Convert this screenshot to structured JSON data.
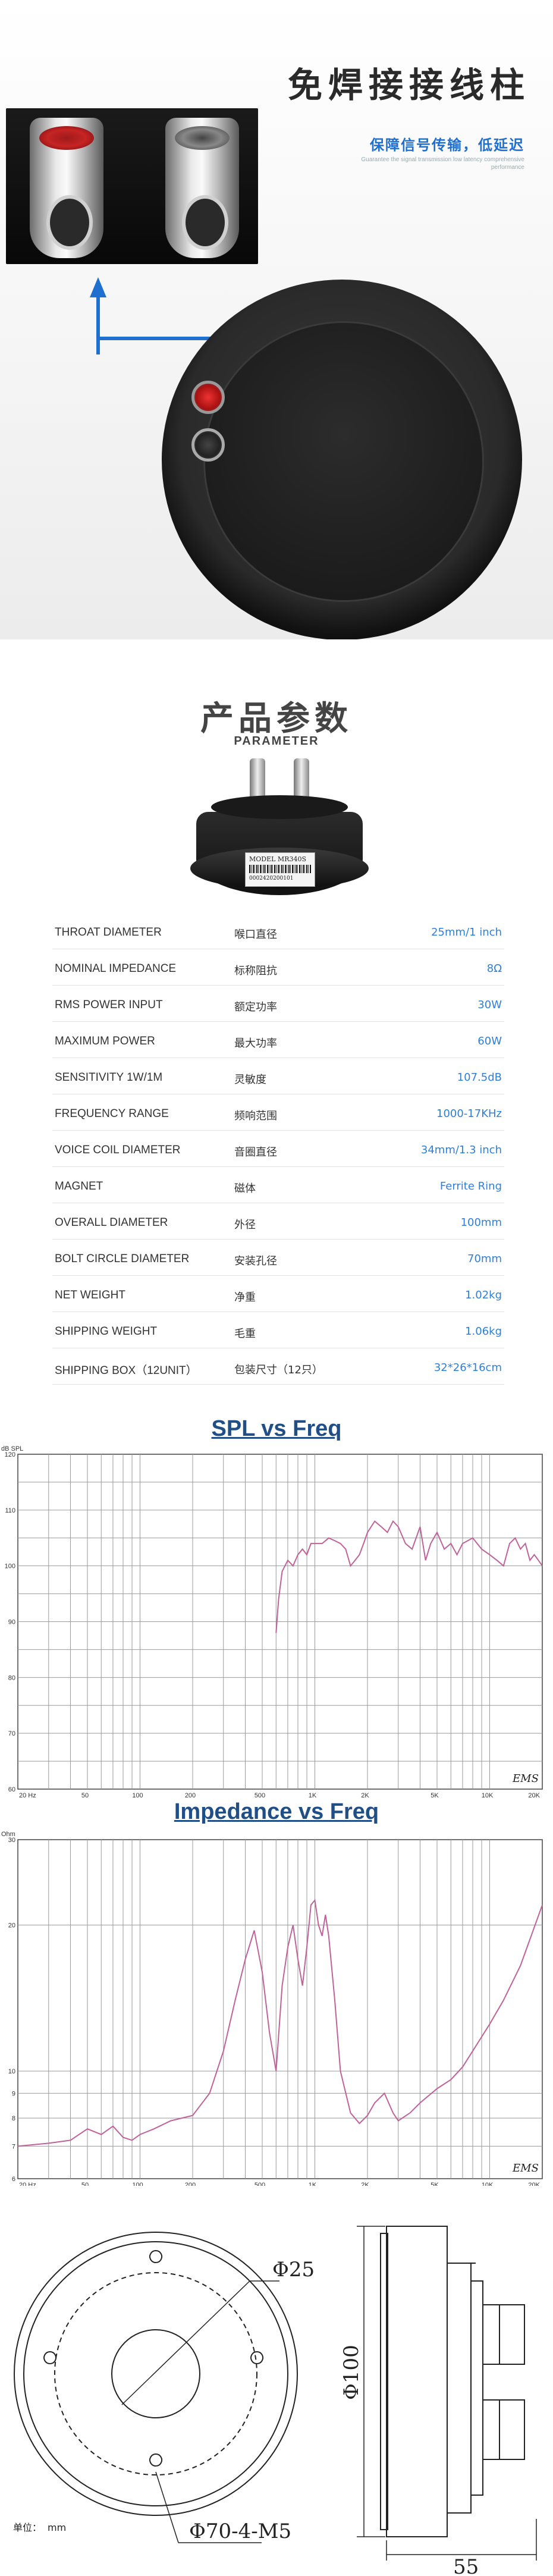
{
  "terminal": {
    "title": "免焊接接线柱",
    "subtitle": "保障信号传输，低延迟",
    "small_text": "Guarantee the signal transmission low latency comprehensive performance"
  },
  "parameters": {
    "title": "产品参数",
    "subtitle": "PARAMETER",
    "product_label": {
      "model": "MODEL MR340S",
      "serial": "0002420200101"
    },
    "rows": [
      {
        "en": "THROAT DIAMETER",
        "cn": "喉口直径",
        "value": "25mm/1 inch"
      },
      {
        "en": "NOMINAL IMPEDANCE",
        "cn": "标称阻抗",
        "value": "8Ω"
      },
      {
        "en": "RMS POWER INPUT",
        "cn": "额定功率",
        "value": "30W"
      },
      {
        "en": "MAXIMUM POWER",
        "cn": "最大功率",
        "value": "60W"
      },
      {
        "en": "SENSITIVITY 1W/1M",
        "cn": "灵敏度",
        "value": "107.5dB"
      },
      {
        "en": "FREQUENCY RANGE",
        "cn": "频响范围",
        "value": "1000-17KHz"
      },
      {
        "en": "VOICE COIL DIAMETER",
        "cn": "音圈直径",
        "value": "34mm/1.3 inch"
      },
      {
        "en": "MAGNET",
        "cn": "磁体",
        "value": "Ferrite Ring"
      },
      {
        "en": "OVERALL DIAMETER",
        "cn": "外径",
        "value": "100mm"
      },
      {
        "en": "BOLT CIRCLE DIAMETER",
        "cn": "安装孔径",
        "value": "70mm"
      },
      {
        "en": "NET WEIGHT",
        "cn": "净重",
        "value": "1.02kg"
      },
      {
        "en": "SHIPPING WEIGHT",
        "cn": "毛重",
        "value": "1.06kg"
      },
      {
        "en": "SHIPPING BOX（12UNIT）",
        "cn": "包装尺寸（12只）",
        "value": "32*26*16cm"
      }
    ]
  },
  "chart_data": [
    {
      "type": "line",
      "title": "SPL vs Freq",
      "ylabel": "dB SPL",
      "xscale": "log",
      "xlim": [
        20,
        20000
      ],
      "ylim": [
        60,
        120
      ],
      "x_ticks": [
        "20 Hz",
        "50",
        "100",
        "200",
        "500",
        "1K",
        "2K",
        "5K",
        "10K",
        "20K"
      ],
      "y_ticks": [
        "120",
        "110",
        "100",
        "90",
        "80",
        "70",
        "60"
      ],
      "grid": true,
      "watermark": "EMS",
      "series": [
        {
          "color": "#c0629a",
          "x": [
            600,
            620,
            650,
            700,
            750,
            800,
            850,
            900,
            950,
            1000,
            1100,
            1200,
            1300,
            1400,
            1500,
            1600,
            1700,
            1800,
            1900,
            2000,
            2200,
            2400,
            2600,
            2800,
            3000,
            3300,
            3600,
            4000,
            4300,
            4600,
            5000,
            5500,
            6000,
            6500,
            7000,
            8000,
            9000,
            10000,
            11000,
            12000,
            13000,
            14000,
            15000,
            16000,
            17000,
            18000,
            19000,
            20000
          ],
          "y": [
            88,
            94,
            99,
            101,
            100,
            102,
            103,
            102,
            104,
            104,
            104,
            105,
            104.5,
            104,
            103,
            100,
            101,
            102,
            104,
            106,
            108,
            107,
            106,
            108,
            107,
            104,
            103,
            107,
            101,
            104,
            106,
            103,
            104,
            102,
            104,
            105,
            103,
            102,
            101,
            100,
            104,
            105,
            103,
            104,
            101,
            102,
            101,
            100
          ]
        }
      ]
    },
    {
      "type": "line",
      "title": "Impedance vs Freq",
      "ylabel": "Ohm",
      "xscale": "log",
      "xlim": [
        20,
        20000
      ],
      "ylim": [
        6,
        30
      ],
      "x_ticks": [
        "20 Hz",
        "50",
        "100",
        "200",
        "500",
        "1K",
        "2K",
        "5K",
        "10K",
        "20K"
      ],
      "y_ticks": [
        "30",
        "20",
        "10",
        "9",
        "8",
        "7",
        "6"
      ],
      "grid": true,
      "watermark": "EMS",
      "series": [
        {
          "color": "#c0629a",
          "x": [
            20,
            30,
            40,
            50,
            60,
            70,
            80,
            90,
            100,
            120,
            150,
            200,
            250,
            300,
            350,
            400,
            450,
            500,
            550,
            600,
            650,
            700,
            750,
            800,
            850,
            900,
            950,
            1000,
            1050,
            1100,
            1150,
            1200,
            1300,
            1400,
            1600,
            1800,
            2000,
            2200,
            2500,
            2800,
            3000,
            3500,
            4000,
            5000,
            6000,
            7000,
            8000,
            10000,
            12000,
            15000,
            20000
          ],
          "y": [
            7,
            7.1,
            7.2,
            7.6,
            7.4,
            7.7,
            7.3,
            7.2,
            7.4,
            7.6,
            7.9,
            8.1,
            9,
            11,
            14,
            17,
            19.5,
            16,
            12,
            10,
            15,
            18,
            20,
            17,
            15,
            18,
            22,
            22.5,
            20,
            19,
            21,
            19,
            14,
            10,
            8.2,
            7.8,
            8.1,
            8.6,
            9,
            8.2,
            7.9,
            8.2,
            8.6,
            9.2,
            9.6,
            10.2,
            11,
            12.5,
            14,
            16.5,
            22
          ]
        }
      ]
    }
  ],
  "drawing": {
    "throat_dim": "Φ25",
    "bolt_dim": "Φ70-4-M5",
    "unit_label": "单位：",
    "unit_value": "mm",
    "height_dim": "Φ100",
    "depth_dim": "55"
  }
}
